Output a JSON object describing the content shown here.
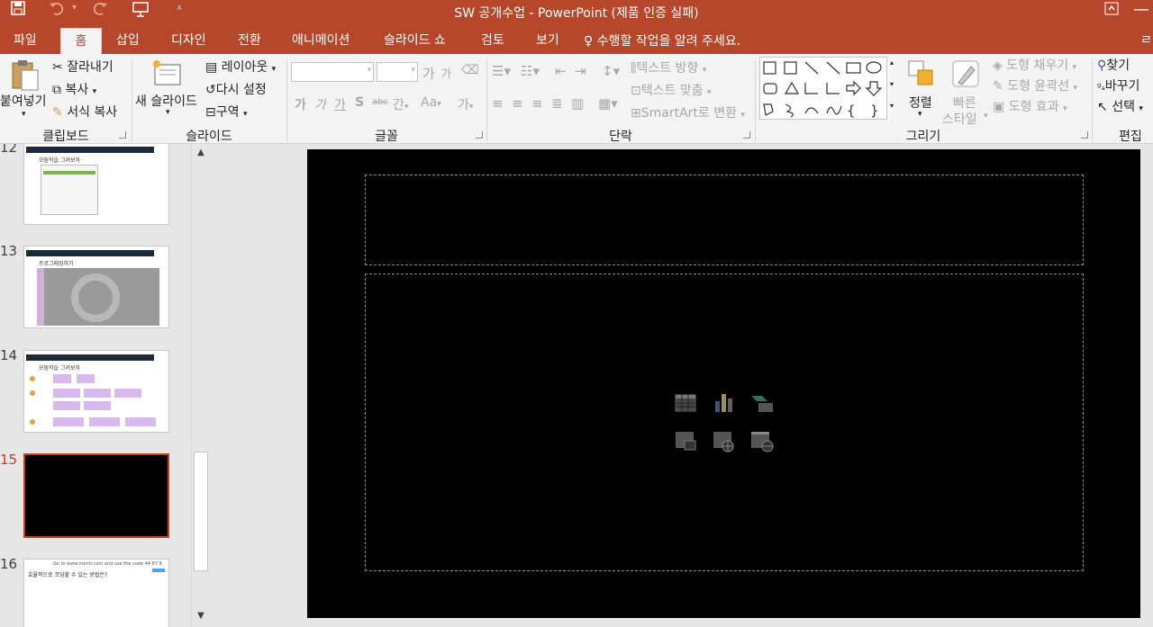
{
  "window": {
    "title": "SW 공개수업 - PowerPoint (제품 인증 실패)"
  },
  "tabs": [
    {
      "label": "파일"
    },
    {
      "label": "홈"
    },
    {
      "label": "삽입"
    },
    {
      "label": "디자인"
    },
    {
      "label": "전환"
    },
    {
      "label": "애니메이션"
    },
    {
      "label": "슬라이드 쇼"
    },
    {
      "label": "검토"
    },
    {
      "label": "보기"
    }
  ],
  "tell_me": "수행할 작업을 알려 주세요.",
  "ribbon": {
    "clipboard": {
      "paste": "붙여넣기",
      "cut": "잘라내기",
      "copy": "복사",
      "format_painter": "서식 복사",
      "group": "클립보드"
    },
    "slides": {
      "new_slide": "새 슬라이드",
      "layout": "레이아웃",
      "reset": "다시 설정",
      "section": "구역",
      "group": "슬라이드"
    },
    "font": {
      "group": "글꼴",
      "grow": "가",
      "shrink": "가",
      "bold": "가",
      "italic": "가",
      "underline": "가",
      "shadow": "S",
      "strike": "abc",
      "spacing": "간",
      "case": "Aa",
      "clear": "가"
    },
    "paragraph": {
      "text_direction": "텍스트 방향",
      "align_text": "텍스트 맞춤",
      "smartart": "SmartArt로 변환",
      "group": "단락"
    },
    "drawing": {
      "arrange": "정렬",
      "quick_styles": "빠른 스타일",
      "fill": "도형 채우기",
      "outline": "도형 윤곽선",
      "effects": "도형 효과",
      "group": "그리기"
    },
    "editing": {
      "find": "찾기",
      "replace": "바꾸기",
      "select": "선택",
      "group": "편집"
    }
  },
  "thumbnails": [
    {
      "number": "12",
      "heading": "모둠학습 그려보자"
    },
    {
      "number": "13",
      "heading": "프로그래밍하기"
    },
    {
      "number": "14",
      "heading": "모둠학습 그려보자"
    },
    {
      "number": "15",
      "heading": ""
    },
    {
      "number": "16",
      "top_line": "Go to www.menti.com and use the code 44 87 8",
      "question": "효율적으로 코딩할 수 있는 방법은?"
    }
  ],
  "colors": {
    "accent": "#b7472a",
    "slide_bg": "#000000",
    "selected_border": "#c43e1c"
  }
}
